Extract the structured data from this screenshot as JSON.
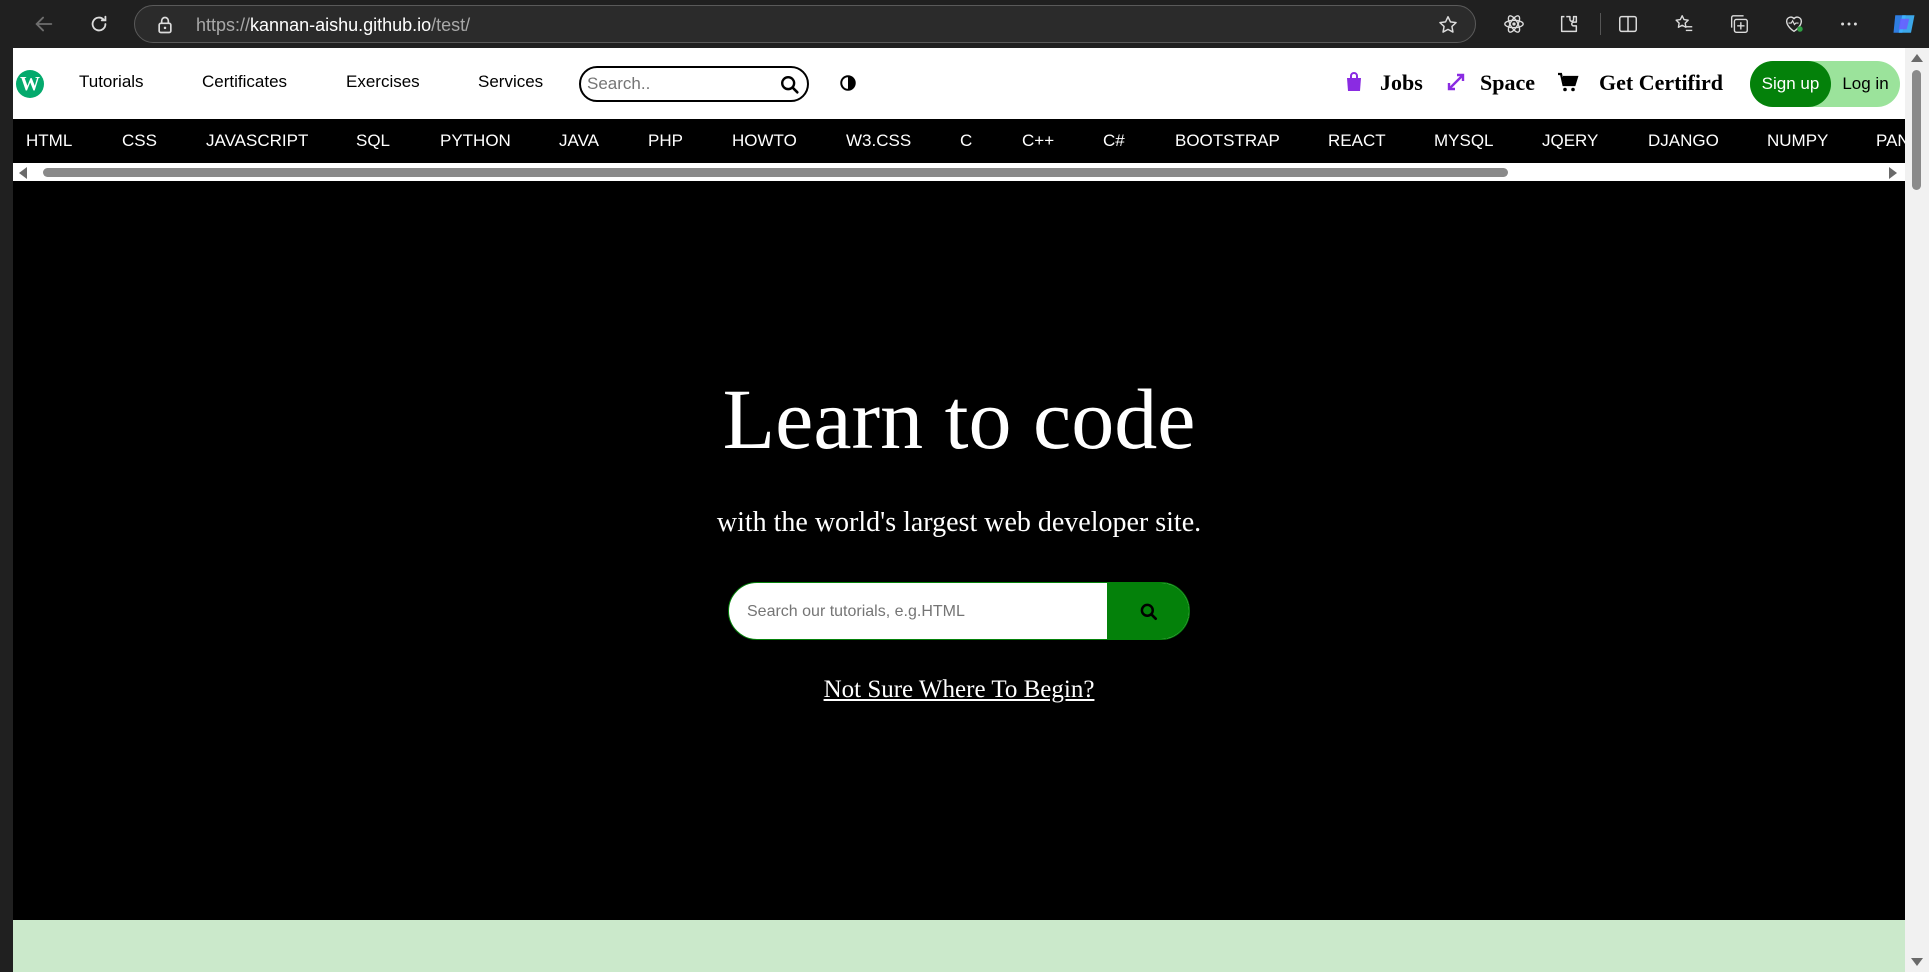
{
  "browser": {
    "url_prefix": "https://",
    "url_host": "kannan-aishu.github.io",
    "url_path": "/test/"
  },
  "nav": {
    "logo_letter": "W",
    "menu": [
      "Tutorials",
      "Certificates",
      "Exercises",
      "Services"
    ],
    "search_placeholder": "Search..",
    "right_links": {
      "jobs": "Jobs",
      "space": "Space",
      "certified": "Get Certifird"
    },
    "signup": "Sign up",
    "login": "Log in"
  },
  "topics": [
    "HTML",
    "CSS",
    "JAVASCRIPT",
    "SQL",
    "PYTHON",
    "JAVA",
    "PHP",
    "HOWTO",
    "W3.CSS",
    "C",
    "C++",
    "C#",
    "BOOTSTRAP",
    "REACT",
    "MYSQL",
    "JQERY",
    "DJANGO",
    "NUMPY",
    "PAN"
  ],
  "hero": {
    "title": "Learn to code",
    "subtitle": "with the world's largest web developer site.",
    "search_placeholder": "Search our tutorials, e.g.HTML",
    "link": "Not Sure Where To Begin?"
  },
  "colors": {
    "brand_green": "#04810a",
    "login_bg": "#9be39b",
    "icon_purple": "#8a2be2",
    "band": "#cbe9cb"
  },
  "icons": [
    "back-arrow-icon",
    "reload-icon",
    "lock-icon",
    "favorite-star-icon",
    "extension-icon",
    "split-screen-icon",
    "favorites-icon",
    "collections-icon",
    "heart-pulse-icon",
    "more-icon",
    "copilot-icon",
    "search-icon",
    "contrast-icon",
    "jobs-bag-icon",
    "space-arrows-icon",
    "cart-icon"
  ]
}
